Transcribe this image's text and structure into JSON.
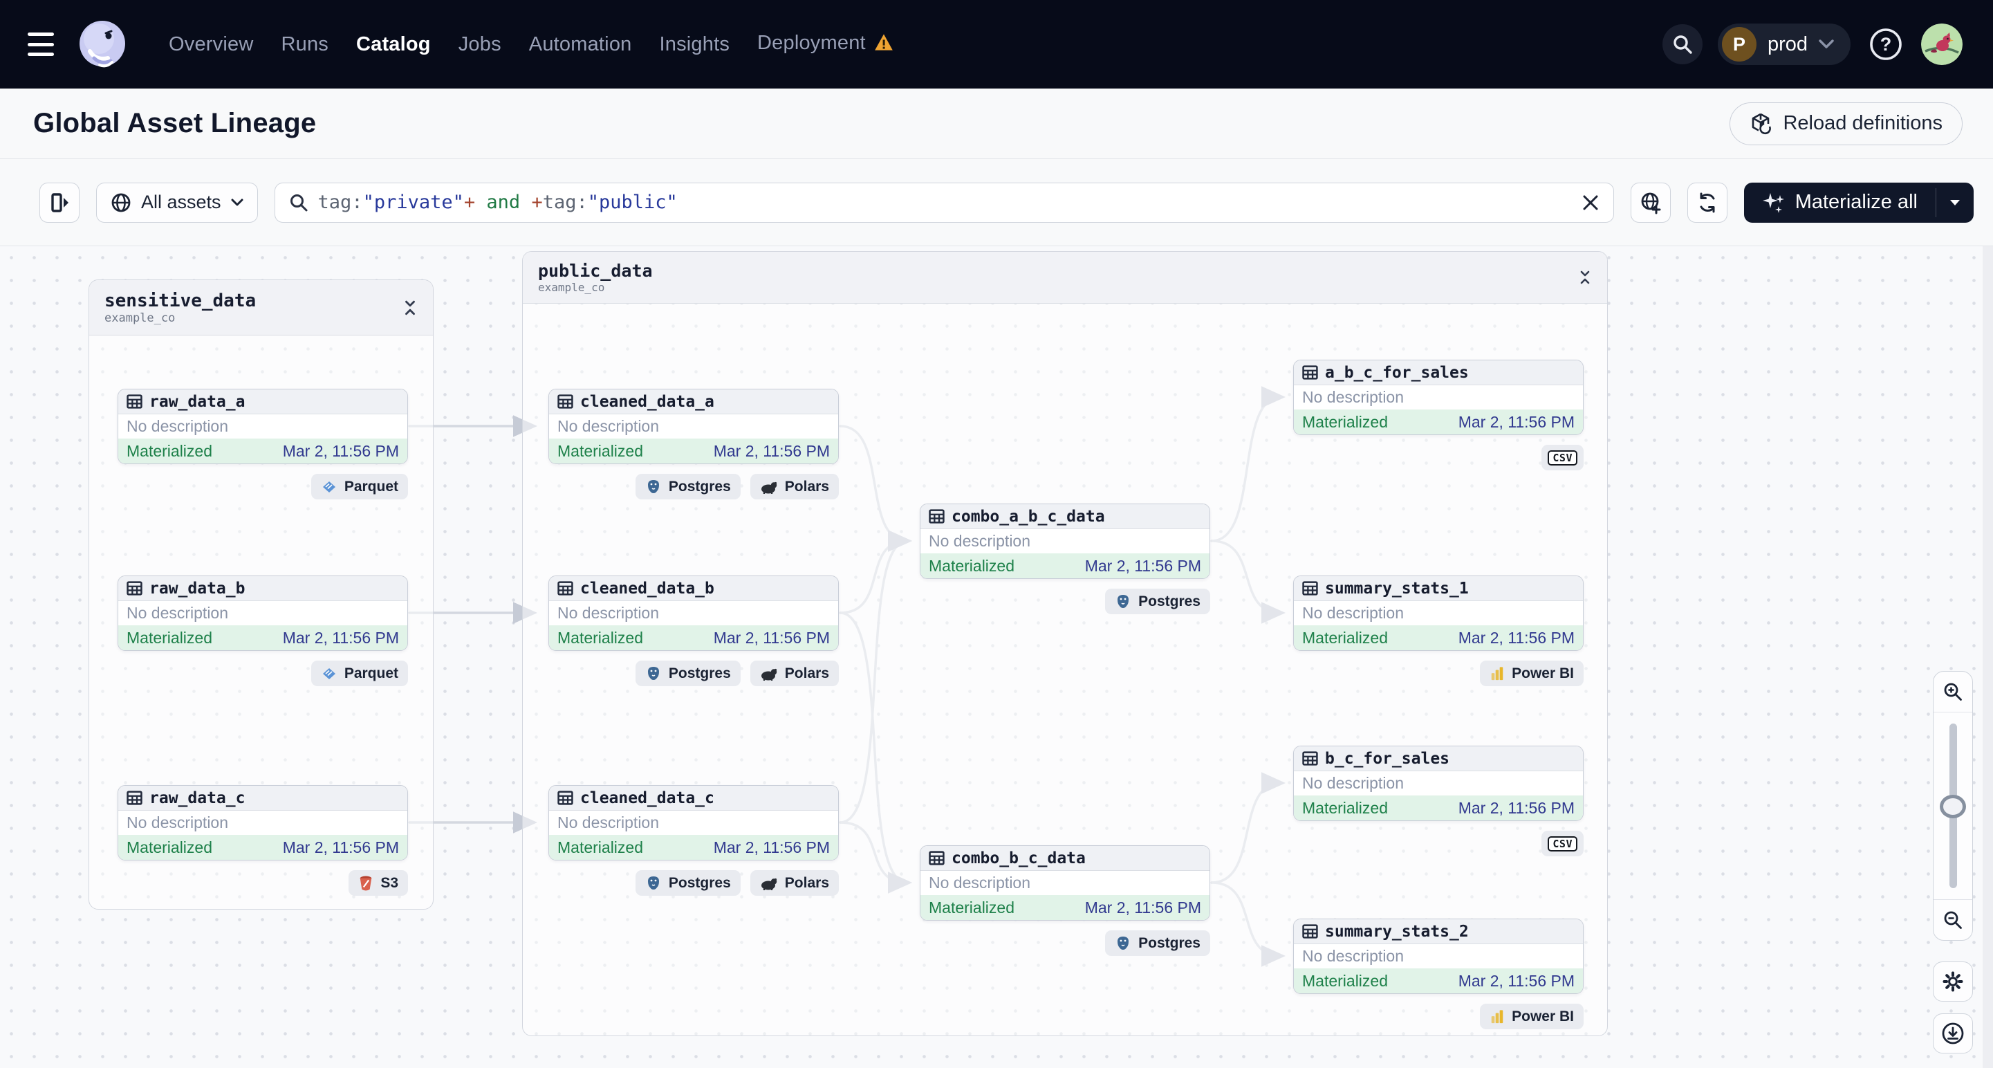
{
  "nav": {
    "items": [
      {
        "label": "Overview"
      },
      {
        "label": "Runs"
      },
      {
        "label": "Catalog",
        "active": true
      },
      {
        "label": "Jobs"
      },
      {
        "label": "Automation"
      },
      {
        "label": "Insights"
      },
      {
        "label": "Deployment",
        "warning": true
      }
    ],
    "environment": {
      "initial": "P",
      "name": "prod"
    }
  },
  "header": {
    "title": "Global Asset Lineage",
    "reload_button_label": "Reload definitions"
  },
  "toolbar": {
    "scope_selector_label": "All assets",
    "materialize_button_label": "Materialize all",
    "search_value": "tag:\"private\"+ and +tag:\"public\"",
    "search_tokens": [
      {
        "text": "tag:",
        "type": "key"
      },
      {
        "text": "\"private\"",
        "type": "string"
      },
      {
        "text": "+",
        "type": "op"
      },
      {
        "text": " and ",
        "type": "bool"
      },
      {
        "text": "+",
        "type": "op"
      },
      {
        "text": "tag:",
        "type": "key"
      },
      {
        "text": "\"public\"",
        "type": "string"
      }
    ]
  },
  "graph": {
    "groups": [
      {
        "name": "sensitive_data",
        "location": "example_co"
      },
      {
        "name": "public_data",
        "location": "example_co"
      }
    ],
    "nodes": [
      {
        "name": "raw_data_a",
        "description": "No description",
        "status": "Materialized",
        "timestamp": "Mar 2, 11:56 PM",
        "tags": [
          {
            "label": "Parquet",
            "icon": "parquet-icon"
          }
        ]
      },
      {
        "name": "raw_data_b",
        "description": "No description",
        "status": "Materialized",
        "timestamp": "Mar 2, 11:56 PM",
        "tags": [
          {
            "label": "Parquet",
            "icon": "parquet-icon"
          }
        ]
      },
      {
        "name": "raw_data_c",
        "description": "No description",
        "status": "Materialized",
        "timestamp": "Mar 2, 11:56 PM",
        "tags": [
          {
            "label": "S3",
            "icon": "s3-icon"
          }
        ]
      },
      {
        "name": "cleaned_data_a",
        "description": "No description",
        "status": "Materialized",
        "timestamp": "Mar 2, 11:56 PM",
        "tags": [
          {
            "label": "Postgres",
            "icon": "postgres-icon"
          },
          {
            "label": "Polars",
            "icon": "polars-icon"
          }
        ]
      },
      {
        "name": "cleaned_data_b",
        "description": "No description",
        "status": "Materialized",
        "timestamp": "Mar 2, 11:56 PM",
        "tags": [
          {
            "label": "Postgres",
            "icon": "postgres-icon"
          },
          {
            "label": "Polars",
            "icon": "polars-icon"
          }
        ]
      },
      {
        "name": "cleaned_data_c",
        "description": "No description",
        "status": "Materialized",
        "timestamp": "Mar 2, 11:56 PM",
        "tags": [
          {
            "label": "Postgres",
            "icon": "postgres-icon"
          },
          {
            "label": "Polars",
            "icon": "polars-icon"
          }
        ]
      },
      {
        "name": "combo_a_b_c_data",
        "description": "No description",
        "status": "Materialized",
        "timestamp": "Mar 2, 11:56 PM",
        "tags": [
          {
            "label": "Postgres",
            "icon": "postgres-icon"
          }
        ]
      },
      {
        "name": "a_b_c_for_sales",
        "description": "No description",
        "status": "Materialized",
        "timestamp": "Mar 2, 11:56 PM",
        "tags": [
          {
            "label": "CSV",
            "icon": "csv-icon"
          }
        ]
      },
      {
        "name": "summary_stats_1",
        "description": "No description",
        "status": "Materialized",
        "timestamp": "Mar 2, 11:56 PM",
        "tags": [
          {
            "label": "Power BI",
            "icon": "powerbi-icon"
          }
        ]
      },
      {
        "name": "b_c_for_sales",
        "description": "No description",
        "status": "Materialized",
        "timestamp": "Mar 2, 11:56 PM",
        "tags": [
          {
            "label": "CSV",
            "icon": "csv-icon"
          }
        ]
      },
      {
        "name": "combo_b_c_data",
        "description": "No description",
        "status": "Materialized",
        "timestamp": "Mar 2, 11:56 PM",
        "tags": [
          {
            "label": "Postgres",
            "icon": "postgres-icon"
          }
        ]
      },
      {
        "name": "summary_stats_2",
        "description": "No description",
        "status": "Materialized",
        "timestamp": "Mar 2, 11:56 PM",
        "tags": [
          {
            "label": "Power BI",
            "icon": "powerbi-icon"
          }
        ]
      }
    ]
  },
  "colors": {
    "nav_background": "#070B19",
    "warning": "#EFA432",
    "materialized_green": "#1D8049",
    "timestamp_indigo": "#31398F",
    "footer_mint": "#E1F3E8",
    "search_string": "#28399B",
    "search_operator": "#A3422C",
    "search_boolean": "#217A45"
  }
}
